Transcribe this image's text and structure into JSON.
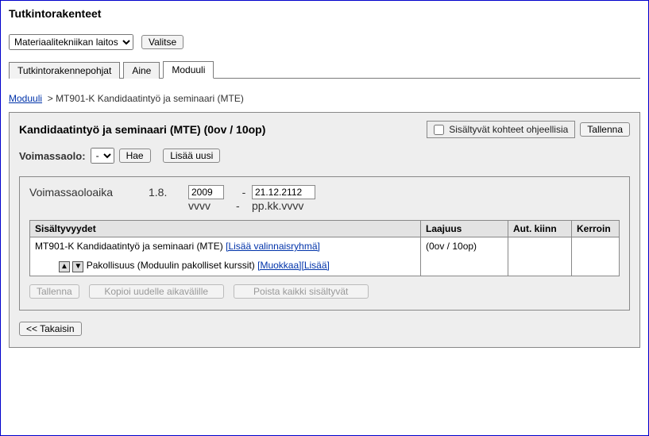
{
  "page_title": "Tutkintorakenteet",
  "department_select": {
    "value": "Materiaalitekniikan laitos"
  },
  "select_btn": "Valitse",
  "tabs": [
    "Tutkintorakennepohjat",
    "Aine",
    "Moduuli"
  ],
  "active_tab": "Moduuli",
  "breadcrumb": {
    "root": "Moduuli",
    "sep": ">",
    "current": "MT901-K Kandidaatintyö ja seminaari (MTE)"
  },
  "panel": {
    "title": "Kandidaatintyö ja seminaari (MTE) (0ov / 10op)",
    "indicative_label": "Sisältyvät kohteet ohjeellisia",
    "indicative_checked": false,
    "save_btn": "Tallenna",
    "validity_label": "Voimassaolo:",
    "validity_value": "-",
    "fetch_btn": "Hae",
    "add_new_btn": "Lisää uusi"
  },
  "validity_block": {
    "label": "Voimassaoloaika",
    "prefix": "1.8.",
    "year_value": "2009",
    "dash": "-",
    "end_value": "21.12.2112",
    "hint_year": "vvvv",
    "hint_date": "pp.kk.vvvv"
  },
  "table": {
    "headers": [
      "Sisältyvyydet",
      "Laajuus",
      "Aut. kiinn",
      "Kerroin"
    ],
    "row": {
      "title_text": "MT901-K Kandidaatintyö ja seminaari (MTE)",
      "add_group_link": "[Lisää valinnaisryhmä]",
      "extent": "(0ov / 10op)",
      "sub_text": "Pakollisuus (Moduulin pakolliset kurssit)",
      "edit_link": "[Muokkaa]",
      "add_link": "[Lisää]"
    }
  },
  "action_buttons": {
    "save": "Tallenna",
    "copy": "Kopioi uudelle aikavälille",
    "delete_all": "Poista kaikki sisältyvät"
  },
  "back_btn": "<< Takaisin"
}
